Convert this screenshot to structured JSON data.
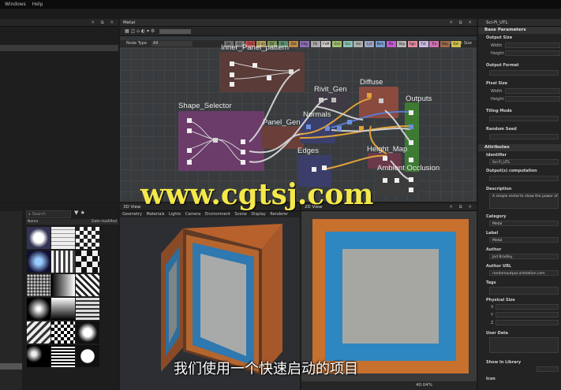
{
  "menu": [
    "Windows",
    "Help"
  ],
  "graph_panel": {
    "title": "Metal",
    "filter_label": "Node Type",
    "filter_value": "All",
    "parent_size": "Parent Size"
  },
  "chips": [
    {
      "label": "Blr",
      "color": "#6e6e6e"
    },
    {
      "label": "Blr",
      "color": "#7a7a7a"
    },
    {
      "label": "ChS",
      "color": "#c14c4c"
    },
    {
      "label": "Curv",
      "color": "#b6a15a"
    },
    {
      "label": "Dir",
      "color": "#7b9a57"
    },
    {
      "label": "Dr",
      "color": "#5b8f6d"
    },
    {
      "label": "Dst",
      "color": "#b98a4a"
    },
    {
      "label": "Edg",
      "color": "#8e6fb6"
    },
    {
      "label": "Fill",
      "color": "#a8a8a8"
    },
    {
      "label": "FxM",
      "color": "#c8c8c8"
    },
    {
      "label": "Grd",
      "color": "#a0c070"
    },
    {
      "label": "Grs",
      "color": "#8ac3b2"
    },
    {
      "label": "Hsl",
      "color": "#b0b0b0"
    },
    {
      "label": "Lvl",
      "color": "#9aa5c2"
    },
    {
      "label": "Nrm",
      "color": "#7aa0d0"
    },
    {
      "label": "Pix",
      "color": "#c05ad0"
    },
    {
      "label": "Shp",
      "color": "#b6b6b6"
    },
    {
      "label": "Sgn",
      "color": "#e08aa0"
    },
    {
      "label": "Txt",
      "color": "#c8b8e0"
    },
    {
      "label": "Tra",
      "color": "#d070b0"
    },
    {
      "label": "Wrp",
      "color": "#a06a4a"
    },
    {
      "label": "Ext",
      "color": "#d0c050"
    }
  ],
  "nodes": {
    "inner": "Inner_Panel_pattern",
    "shape": "Shape_Selector",
    "panel": "Panel_Gen",
    "normals": "Normals",
    "rivit": "Rivit_Gen",
    "diffuse": "Diffuse",
    "outputs": "Outputs",
    "edges": "Edges",
    "height": "Height_Map",
    "ambient": "Ambient Occlusion"
  },
  "library": {
    "search_placeholder": "Search",
    "col_name": "Name",
    "col_date": "Date modified"
  },
  "view3d": {
    "title": "3D View",
    "menu": [
      "Geometry",
      "Materials",
      "Lights",
      "Camera",
      "Environment",
      "Scene",
      "Display",
      "Renderer"
    ]
  },
  "view2d": {
    "title": "2D View",
    "zoom": "40.04%"
  },
  "props": {
    "title": "Sci-Fi_UTL",
    "base_params": "Base Parameters",
    "output_size": "Output Size",
    "width": "Width",
    "height": "Height",
    "output_format": "Output Format",
    "pixel_size": "Pixel Size",
    "tiling_mode": "Tiling Mode",
    "random_seed": "Random Seed",
    "attributes": "Attributes",
    "identifier": "Identifier",
    "identifier_value": "Sci-Fi_UTL",
    "output_comp": "Output(s) computation",
    "description": "Description",
    "description_value": "A simple metal to show the power of SD",
    "category": "Category",
    "category_value": "Metal",
    "label": "Label",
    "label_value": "Metal",
    "author": "Author",
    "author_value": "Jod Bradley",
    "author_url": "Author URL",
    "author_url_value": "randomoutput.artstation.com",
    "tags": "Tags",
    "physical_size": "Physical Size",
    "x": "X",
    "y": "Y",
    "z": "Z",
    "user_data": "User Data",
    "show_in_library": "Show In Library",
    "icon": "Icon"
  },
  "overlay": {
    "watermark": "www.cgtsj.com",
    "subtitle": "我们使用一个快速启动的项目"
  },
  "colors": {
    "accent": "#f4e84a",
    "diffuse_frame": "#8a4a3e",
    "outputs_frame": "#3f7a34",
    "shape_frame": "#7a3a7a"
  }
}
